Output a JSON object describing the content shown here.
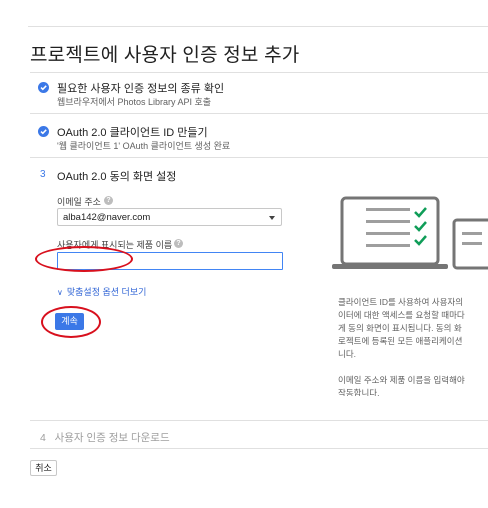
{
  "page": {
    "title": "프로젝트에 사용자 인증 정보 추가"
  },
  "steps": [
    {
      "title": "필요한 사용자 인증 정보의 종류 확인",
      "subtitle": "웹브라우저에서 Photos Library API 호출"
    },
    {
      "title": "OAuth 2.0 클라이언트 ID 만들기",
      "subtitle": "'웹 클라이언트 1' OAuth 클라이언트 생성 완료"
    },
    {
      "number": "3",
      "title": "OAuth 2.0 동의 화면 설정"
    },
    {
      "number": "4",
      "title": "사용자 인증 정보 다운로드"
    }
  ],
  "form": {
    "email_label": "이메일 주소",
    "email_value": "alba142@naver.com",
    "product_name_label": "사용자에게 표시되는 제품 이름",
    "product_name_value": "",
    "more_options": "맞춤설정 옵션 더보기",
    "continue_label": "계속",
    "cancel_label": "취소"
  },
  "description": {
    "para1": "클라이언트 ID를 사용하여 사용자의\n이터에 대한 액세스를 요청할 때마다\n게 동의 화면이 표시됩니다. 동의 화\n로젝트에 등록된 모든 애플리케이션\n니다.",
    "para2": "이메일 주소와 제품 이름을 입력해야\n작동합니다."
  },
  "colors": {
    "accent": "#3b78e7",
    "annotation_ring": "#d8101d"
  }
}
